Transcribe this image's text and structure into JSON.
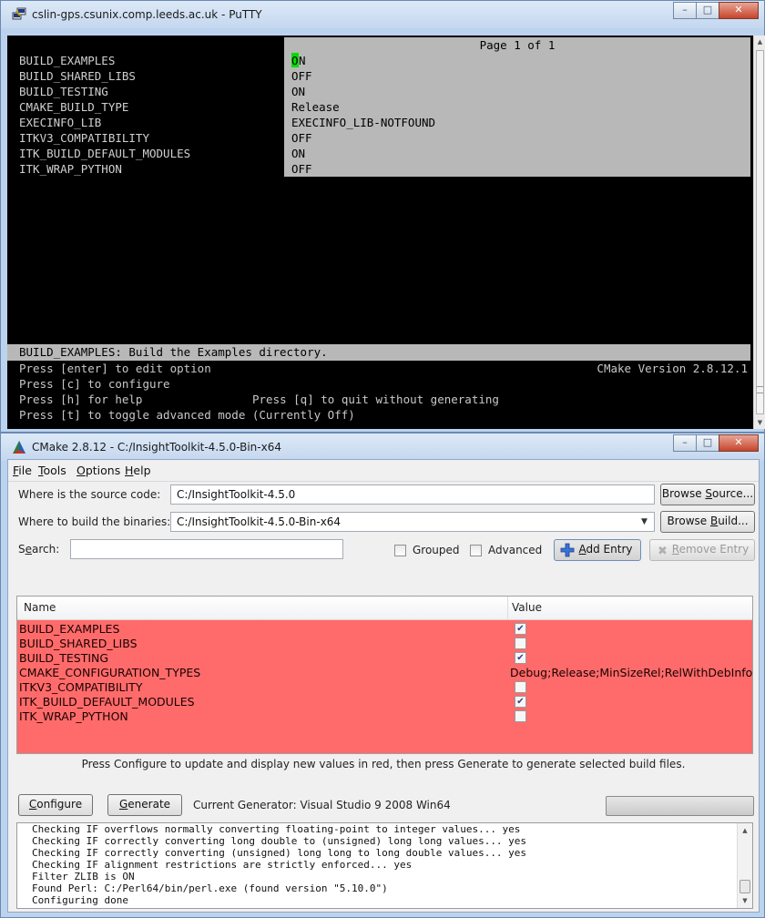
{
  "putty": {
    "title": "cslin-gps.csunix.comp.leeds.ac.uk - PuTTY",
    "page_header": "Page 1 of 1",
    "options": [
      {
        "key": "BUILD_EXAMPLES",
        "value": "N",
        "cursor_char": "O"
      },
      {
        "key": "BUILD_SHARED_LIBS",
        "value": "OFF"
      },
      {
        "key": "BUILD_TESTING",
        "value": "ON"
      },
      {
        "key": "CMAKE_BUILD_TYPE",
        "value": "Release"
      },
      {
        "key": "EXECINFO_LIB",
        "value": "EXECINFO_LIB-NOTFOUND"
      },
      {
        "key": "ITKV3_COMPATIBILITY",
        "value": "OFF"
      },
      {
        "key": "ITK_BUILD_DEFAULT_MODULES",
        "value": "ON"
      },
      {
        "key": "ITK_WRAP_PYTHON",
        "value": "OFF"
      }
    ],
    "help_bar": "BUILD_EXAMPLES: Build the Examples directory.",
    "footer": {
      "line1": "Press [enter] to edit option",
      "version": "CMake Version 2.8.12.1",
      "line2": "Press [c] to configure",
      "line3_left": "Press [h] for help",
      "line3_right": "Press [q] to quit without generating",
      "line4": "Press [t] to toggle advanced mode (Currently Off)"
    }
  },
  "cmake": {
    "title": "CMake 2.8.12 - C:/InsightToolkit-4.5.0-Bin-x64",
    "menu": [
      {
        "mnemonic": "F",
        "rest": "ile"
      },
      {
        "mnemonic": "T",
        "rest": "ools"
      },
      {
        "mnemonic": "O",
        "rest": "ptions"
      },
      {
        "mnemonic": "H",
        "rest": "elp"
      }
    ],
    "source_label": "Where is the source code:",
    "source_value": "C:/InsightToolkit-4.5.0",
    "browse_source": {
      "pre": "Browse ",
      "mnemonic": "S",
      "post": "ource..."
    },
    "build_label": "Where to build the binaries:",
    "build_value": "C:/InsightToolkit-4.5.0-Bin-x64",
    "browse_build": {
      "pre": "Browse ",
      "mnemonic": "B",
      "post": "uild..."
    },
    "search_label": {
      "pre": "S",
      "mnemonic": "e",
      "post": "arch:"
    },
    "search_value": "",
    "grouped_label": "Grouped",
    "advanced_label": "Advanced",
    "add_entry": {
      "mnemonic": "A",
      "post": "dd Entry"
    },
    "remove_entry": {
      "mnemonic": "R",
      "post": "emove Entry"
    },
    "table": {
      "col_name": "Name",
      "col_value": "Value",
      "rows": [
        {
          "name": "BUILD_EXAMPLES",
          "type": "bool",
          "checked": true
        },
        {
          "name": "BUILD_SHARED_LIBS",
          "type": "bool",
          "checked": false
        },
        {
          "name": "BUILD_TESTING",
          "type": "bool",
          "checked": true
        },
        {
          "name": "CMAKE_CONFIGURATION_TYPES",
          "type": "string",
          "value": "Debug;Release;MinSizeRel;RelWithDebInfo"
        },
        {
          "name": "ITKV3_COMPATIBILITY",
          "type": "bool",
          "checked": false
        },
        {
          "name": "ITK_BUILD_DEFAULT_MODULES",
          "type": "bool",
          "checked": true
        },
        {
          "name": "ITK_WRAP_PYTHON",
          "type": "bool",
          "checked": false
        }
      ]
    },
    "hint": "Press Configure to update and display new values in red, then press Generate to generate selected build files.",
    "configure": {
      "mnemonic": "C",
      "post": "onfigure"
    },
    "generate": {
      "mnemonic": "G",
      "post": "enerate"
    },
    "generator": "Current Generator: Visual Studio 9 2008 Win64",
    "progress": 0,
    "log": [
      "Checking IF overflows normally converting floating-point to integer values... yes",
      "Checking IF correctly converting long double to (unsigned) long long values... yes",
      "Checking IF correctly converting (unsigned) long long to long double values... yes",
      "Checking IF alignment restrictions are strictly enforced... yes",
      "Filter ZLIB is ON",
      "Found Perl: C:/Perl64/bin/perl.exe (found version \"5.10.0\")",
      "Configuring done"
    ]
  },
  "colors": {
    "changed_row": "#ff6b6b",
    "terminal_bg": "#000000",
    "terminal_highlight": "#b8b8b8",
    "cursor": "#00dd00",
    "cmake_logo": "#1f5fbf"
  },
  "icons": {
    "putty": "putty-icon",
    "cmake": "cmake-triangle-icon",
    "add": "plus-icon",
    "remove": "remove-x-icon"
  }
}
